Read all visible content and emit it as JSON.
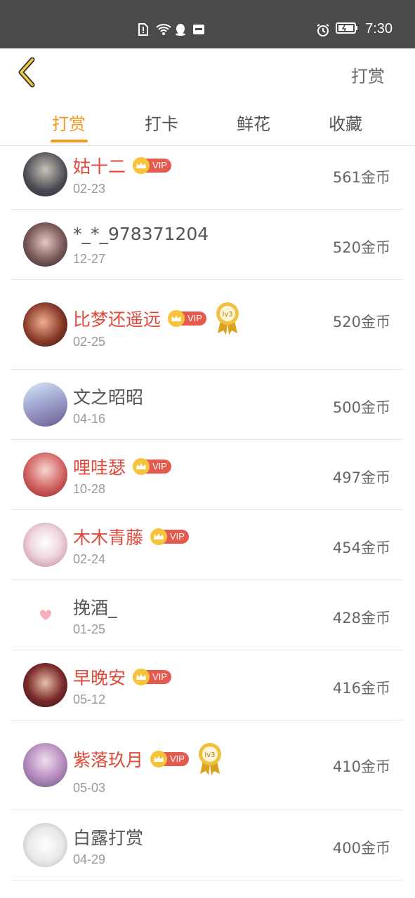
{
  "status_bar": {
    "time": "7:30"
  },
  "header": {
    "back_icon": "chevron-left-icon",
    "action_label": "打赏"
  },
  "tabs": [
    {
      "label": "打赏",
      "active": true
    },
    {
      "label": "打卡",
      "active": false
    },
    {
      "label": "鲜花",
      "active": false
    },
    {
      "label": "收藏",
      "active": false
    }
  ],
  "colors": {
    "accent": "#f29a1f",
    "vip_name": "#e0483a",
    "vip_badge": "#e45a4f",
    "crown": "#f7c33a"
  },
  "list": [
    {
      "name": "姑十二",
      "vip": true,
      "vip_label": "VIP",
      "medal": false,
      "date": "02-23",
      "amount": "561金币"
    },
    {
      "name": "*_*_978371204",
      "vip": false,
      "medal": false,
      "date": "12-27",
      "amount": "520金币"
    },
    {
      "name": "比梦还遥远",
      "vip": true,
      "vip_label": "VIP",
      "medal": true,
      "medal_label": "lv3",
      "date": "02-25",
      "amount": "520金币"
    },
    {
      "name": "文之昭昭",
      "vip": false,
      "medal": false,
      "date": "04-16",
      "amount": "500金币"
    },
    {
      "name": "哩哇瑟",
      "vip": true,
      "vip_label": "VIP",
      "medal": false,
      "date": "10-28",
      "amount": "497金币"
    },
    {
      "name": "木木青藤",
      "vip": true,
      "vip_label": "VIP",
      "medal": false,
      "date": "02-24",
      "amount": "454金币"
    },
    {
      "name": "挽酒_",
      "vip": false,
      "medal": false,
      "date": "01-25",
      "amount": "428金币"
    },
    {
      "name": "早晚安",
      "vip": true,
      "vip_label": "VIP",
      "medal": false,
      "date": "05-12",
      "amount": "416金币"
    },
    {
      "name": "紫落玖月",
      "vip": true,
      "vip_label": "VIP",
      "medal": true,
      "medal_label": "lv3",
      "date": "05-03",
      "amount": "410金币"
    },
    {
      "name": "白露打赏",
      "vip": false,
      "medal": false,
      "date": "04-29",
      "amount": "400金币"
    }
  ]
}
